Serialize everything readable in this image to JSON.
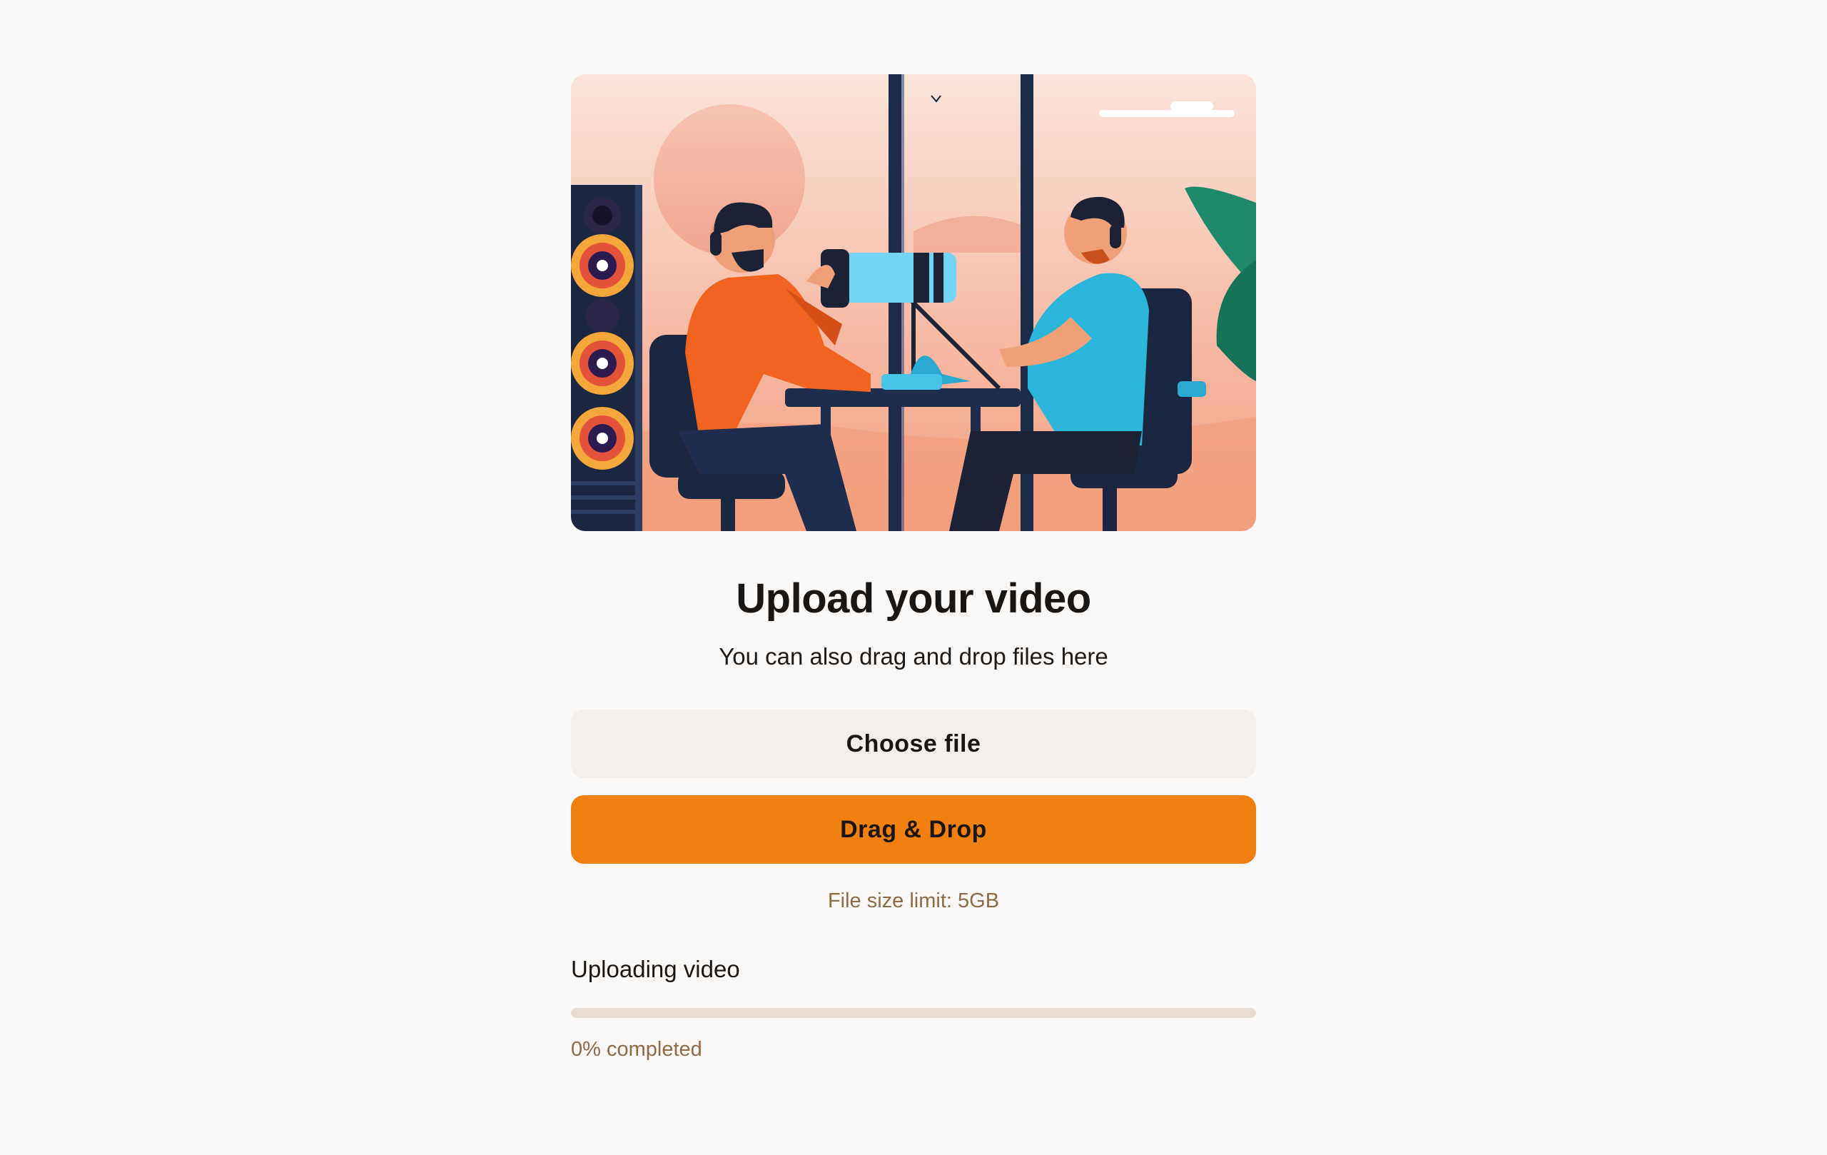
{
  "hero": {
    "alt": "Illustration of two people recording a podcast at a desk with microphone and speakers"
  },
  "upload": {
    "title": "Upload your video",
    "subtitle": "You can also drag and drop files here",
    "choose_label": "Choose file",
    "drop_label": "Drag & Drop",
    "limit_text": "File size limit: 5GB"
  },
  "progress": {
    "label": "Uploading video",
    "percent": 0,
    "status_text": "0% completed"
  },
  "colors": {
    "accent": "#F0800F",
    "muted_text": "#8F6A44",
    "track": "#E8DDD3",
    "secondary_button": "#F3EEE9",
    "background": "#FBF9F7"
  }
}
